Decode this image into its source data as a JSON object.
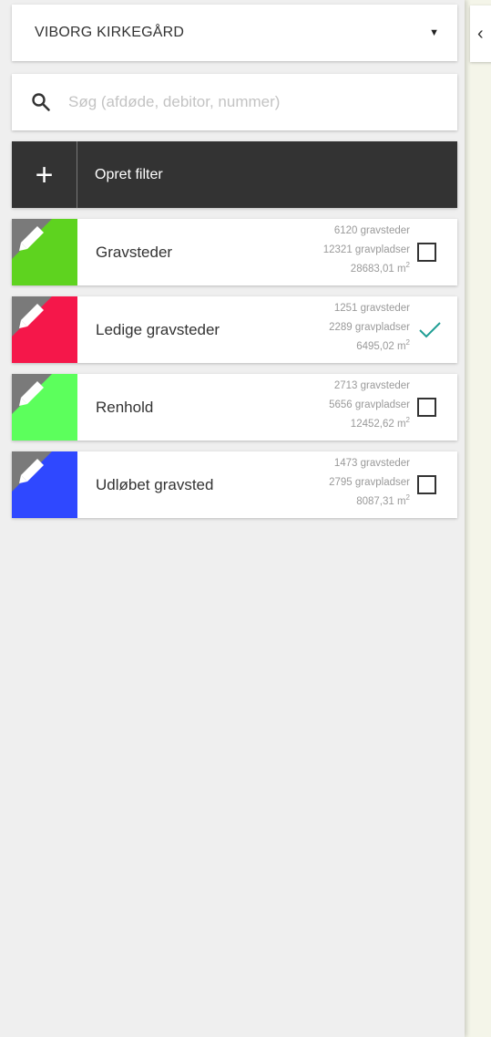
{
  "location": {
    "selected": "VIBORG KIRKEGÅRD",
    "arrow": "▼"
  },
  "search": {
    "placeholder": "Søg (afdøde, debitor, nummer)",
    "value": ""
  },
  "create_filter": {
    "icon": "+",
    "label": "Opret filter"
  },
  "filters": [
    {
      "name": "Gravsteder",
      "color": "#5ed31f",
      "gravsteder": "6120 gravsteder",
      "gravpladser": "12321 gravpladser",
      "area": "28683,01 m",
      "area_unit_sup": "2",
      "checked": false
    },
    {
      "name": "Ledige gravsteder",
      "color": "#f5174a",
      "gravsteder": "1251 gravsteder",
      "gravpladser": "2289 gravpladser",
      "area": "6495,02 m",
      "area_unit_sup": "2",
      "checked": true
    },
    {
      "name": "Renhold",
      "color": "#5cff5c",
      "gravsteder": "2713 gravsteder",
      "gravpladser": "5656 gravpladser",
      "area": "12452,62 m",
      "area_unit_sup": "2",
      "checked": false
    },
    {
      "name": "Udløbet gravsted",
      "color": "#2f48ff",
      "gravsteder": "1473 gravsteder",
      "gravpladser": "2795 gravpladser",
      "area": "8087,31 m",
      "area_unit_sup": "2",
      "checked": false
    }
  ],
  "colors": {
    "edit_corner": "#7a7a7a",
    "checkmark": "#1f9e94",
    "dark_bar": "#333333"
  },
  "collapse": {
    "icon": "‹"
  }
}
